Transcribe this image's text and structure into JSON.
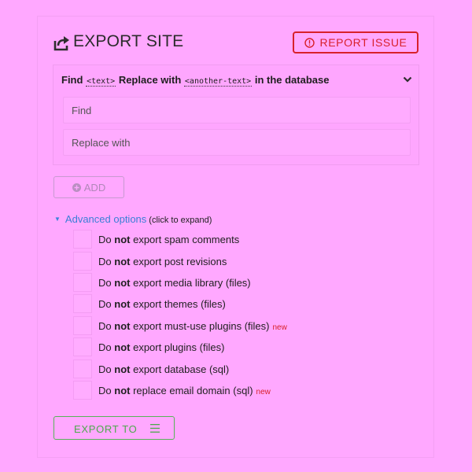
{
  "header": {
    "title": "EXPORT SITE",
    "report_label": "REPORT ISSUE"
  },
  "find_replace": {
    "label_find": "Find",
    "code_text": "<text>",
    "label_replace": "Replace with",
    "code_another": "<another-text>",
    "label_suffix": "in the database",
    "find_placeholder": "Find",
    "replace_placeholder": "Replace with"
  },
  "add_label": "ADD",
  "advanced": {
    "link": "Advanced options",
    "hint": "(click to expand)"
  },
  "options": [
    {
      "prefix": "Do",
      "bold": "not",
      "text": "export spam comments",
      "badge": ""
    },
    {
      "prefix": "Do",
      "bold": "not",
      "text": "export post revisions",
      "badge": ""
    },
    {
      "prefix": "Do",
      "bold": "not",
      "text": "export media library (files)",
      "badge": ""
    },
    {
      "prefix": "Do",
      "bold": "not",
      "text": "export themes (files)",
      "badge": ""
    },
    {
      "prefix": "Do",
      "bold": "not",
      "text": "export must-use plugins (files)",
      "badge": "new"
    },
    {
      "prefix": "Do",
      "bold": "not",
      "text": "export plugins (files)",
      "badge": ""
    },
    {
      "prefix": "Do",
      "bold": "not",
      "text": "export database (sql)",
      "badge": ""
    },
    {
      "prefix": "Do",
      "bold": "not",
      "text": "replace email domain (sql)",
      "badge": "new"
    }
  ],
  "export_to_label": "EXPORT TO",
  "colors": {
    "background": "#ffa8ff",
    "danger": "#d8212a",
    "link": "#3a7fd6",
    "success": "#4da94d"
  },
  "icons": {
    "title": "export-share-icon",
    "report": "alert-circle-icon",
    "collapse": "chevron-down-icon",
    "add": "plus-circle-icon",
    "advanced": "triangle-down-icon",
    "export_menu": "menu-icon"
  }
}
